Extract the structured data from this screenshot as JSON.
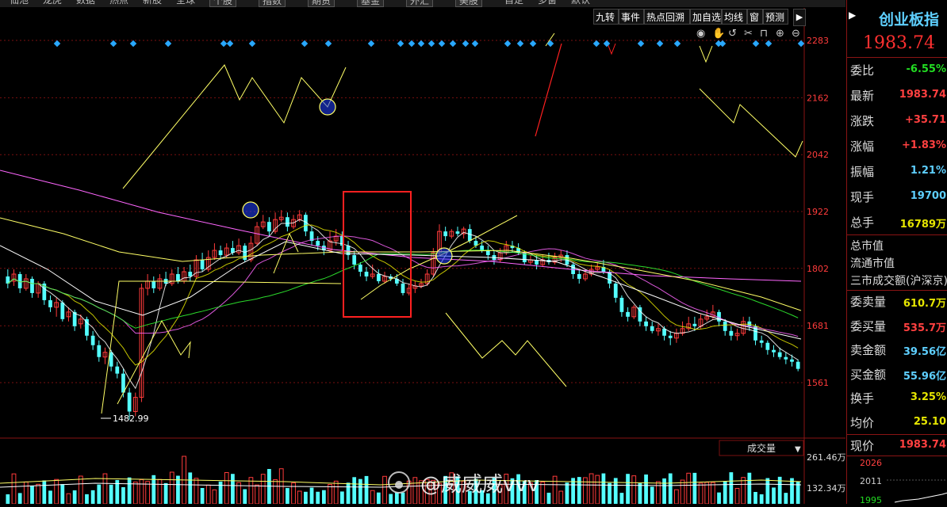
{
  "top_tabs": [
    "仙池",
    "龙虎",
    "数据",
    "热点",
    "新股",
    "全球",
    "个股",
    "指数",
    "期货",
    "基金",
    "外汇",
    "美股",
    "自定",
    "多窗",
    "默认"
  ],
  "toolbar": {
    "buttons": [
      "九转",
      "事件",
      "热点回溯",
      "加自选",
      "均线",
      "窗",
      "预测"
    ],
    "chart_icons": [
      "eye-icon",
      "hand-icon",
      "undo-icon",
      "cut-icon",
      "lock-icon",
      "zoom-in-icon",
      "zoom-out-icon"
    ]
  },
  "y_axis_labels": [
    "2283",
    "2162",
    "2042",
    "1922",
    "1802",
    "1681",
    "1561"
  ],
  "volume": {
    "indicator_label": "成交量",
    "axis_labels": [
      "261.46万",
      "132.34万"
    ]
  },
  "low_marker_label": "1482.99",
  "watermark": "@威威威vvv",
  "right_panel": {
    "title": "创业板指",
    "price": "1983.74",
    "rows": [
      {
        "label": "委比",
        "value": "-6.55%",
        "color": "#22dd22"
      },
      {
        "label": "最新",
        "value": "1983.74",
        "color": "#ff4040"
      },
      {
        "label": "涨跌",
        "value": "+35.71",
        "color": "#ff4040"
      },
      {
        "label": "涨幅",
        "value": "+1.83%",
        "color": "#ff4040"
      },
      {
        "label": "振幅",
        "value": "1.21%",
        "color": "#5ecfff"
      },
      {
        "label": "现手",
        "value": "19700",
        "color": "#5ecfff"
      },
      {
        "label": "总手",
        "value": "16789万",
        "color": "#e6e600"
      }
    ],
    "rows2": [
      {
        "label": "总市值",
        "value": ""
      },
      {
        "label": "流通市值",
        "value": ""
      },
      {
        "label": "三市成交额(沪深京)",
        "value": ""
      }
    ],
    "rows3": [
      {
        "label": "委卖量",
        "value": "610.7万",
        "color": "#e6e600"
      },
      {
        "label": "委买量",
        "value": "535.7万",
        "color": "#ff4040"
      },
      {
        "label": "卖金额",
        "value": "39.56亿",
        "color": "#5ecfff"
      },
      {
        "label": "买金额",
        "value": "55.96亿",
        "color": "#5ecfff"
      },
      {
        "label": "换手",
        "value": "3.25%",
        "color": "#e6e600"
      },
      {
        "label": "均价",
        "value": "25.10",
        "color": "#e6e600"
      }
    ],
    "last_row": {
      "label": "现价",
      "value": "1983.74",
      "color": "#ff4040"
    },
    "mini_axis": [
      "2026",
      "2011",
      "1995"
    ]
  },
  "chart_data": {
    "type": "candlestick",
    "ylim": [
      1440,
      2340
    ],
    "y_ticks": [
      2283,
      2162,
      2042,
      1922,
      1802,
      1681,
      1561
    ],
    "low_point": 1482.99,
    "candles": [
      [
        1785,
        1770,
        1800,
        1760
      ],
      [
        1775,
        1790,
        1800,
        1765
      ],
      [
        1790,
        1760,
        1795,
        1750
      ],
      [
        1760,
        1780,
        1790,
        1755
      ],
      [
        1780,
        1750,
        1785,
        1740
      ],
      [
        1750,
        1770,
        1775,
        1740
      ],
      [
        1770,
        1735,
        1775,
        1725
      ],
      [
        1735,
        1720,
        1745,
        1710
      ],
      [
        1720,
        1730,
        1740,
        1700
      ],
      [
        1730,
        1695,
        1735,
        1690
      ],
      [
        1700,
        1710,
        1720,
        1690
      ],
      [
        1710,
        1680,
        1715,
        1670
      ],
      [
        1685,
        1695,
        1705,
        1675
      ],
      [
        1695,
        1660,
        1700,
        1650
      ],
      [
        1660,
        1640,
        1670,
        1630
      ],
      [
        1640,
        1615,
        1650,
        1605
      ],
      [
        1615,
        1625,
        1635,
        1600
      ],
      [
        1625,
        1595,
        1630,
        1585
      ],
      [
        1595,
        1580,
        1605,
        1570
      ],
      [
        1580,
        1540,
        1590,
        1530
      ],
      [
        1540,
        1500,
        1550,
        1483
      ],
      [
        1500,
        1530,
        1540,
        1490
      ],
      [
        1530,
        1760,
        1770,
        1520
      ],
      [
        1760,
        1775,
        1790,
        1745
      ],
      [
        1775,
        1760,
        1785,
        1750
      ],
      [
        1760,
        1780,
        1790,
        1755
      ],
      [
        1780,
        1770,
        1795,
        1765
      ],
      [
        1770,
        1790,
        1800,
        1765
      ],
      [
        1790,
        1775,
        1805,
        1770
      ],
      [
        1775,
        1795,
        1805,
        1770
      ],
      [
        1795,
        1785,
        1810,
        1775
      ],
      [
        1785,
        1820,
        1830,
        1780
      ],
      [
        1820,
        1800,
        1835,
        1795
      ],
      [
        1800,
        1825,
        1840,
        1795
      ],
      [
        1825,
        1840,
        1855,
        1820
      ],
      [
        1840,
        1830,
        1850,
        1820
      ],
      [
        1830,
        1845,
        1855,
        1825
      ],
      [
        1845,
        1835,
        1860,
        1830
      ],
      [
        1835,
        1850,
        1865,
        1830
      ],
      [
        1850,
        1820,
        1855,
        1815
      ],
      [
        1820,
        1855,
        1870,
        1815
      ],
      [
        1855,
        1890,
        1900,
        1850
      ],
      [
        1890,
        1900,
        1915,
        1885
      ],
      [
        1900,
        1880,
        1910,
        1870
      ],
      [
        1880,
        1905,
        1920,
        1875
      ],
      [
        1905,
        1910,
        1925,
        1900
      ],
      [
        1910,
        1890,
        1920,
        1880
      ],
      [
        1890,
        1905,
        1915,
        1885
      ],
      [
        1905,
        1915,
        1925,
        1900
      ],
      [
        1915,
        1880,
        1920,
        1870
      ],
      [
        1880,
        1860,
        1890,
        1850
      ],
      [
        1860,
        1850,
        1870,
        1840
      ],
      [
        1850,
        1840,
        1860,
        1830
      ],
      [
        1840,
        1860,
        1880,
        1835
      ],
      [
        1860,
        1870,
        1885,
        1850
      ],
      [
        1870,
        1850,
        1880,
        1840
      ],
      [
        1850,
        1830,
        1860,
        1820
      ],
      [
        1830,
        1810,
        1840,
        1800
      ],
      [
        1810,
        1795,
        1815,
        1785
      ],
      [
        1795,
        1785,
        1805,
        1775
      ],
      [
        1785,
        1790,
        1810,
        1780
      ],
      [
        1790,
        1775,
        1800,
        1770
      ],
      [
        1775,
        1785,
        1795,
        1770
      ],
      [
        1785,
        1780,
        1790,
        1775
      ],
      [
        1780,
        1770,
        1790,
        1765
      ],
      [
        1770,
        1750,
        1780,
        1745
      ],
      [
        1750,
        1760,
        1770,
        1745
      ],
      [
        1760,
        1765,
        1775,
        1750
      ],
      [
        1765,
        1770,
        1780,
        1760
      ],
      [
        1770,
        1790,
        1800,
        1765
      ],
      [
        1790,
        1835,
        1845,
        1785
      ],
      [
        1835,
        1880,
        1895,
        1830
      ],
      [
        1880,
        1870,
        1890,
        1860
      ],
      [
        1870,
        1880,
        1885,
        1865
      ],
      [
        1880,
        1875,
        1890,
        1870
      ],
      [
        1875,
        1885,
        1890,
        1865
      ],
      [
        1885,
        1860,
        1895,
        1855
      ],
      [
        1860,
        1850,
        1870,
        1845
      ],
      [
        1850,
        1840,
        1860,
        1835
      ],
      [
        1840,
        1830,
        1850,
        1820
      ],
      [
        1830,
        1820,
        1840,
        1810
      ],
      [
        1820,
        1835,
        1845,
        1815
      ],
      [
        1835,
        1850,
        1860,
        1830
      ],
      [
        1850,
        1845,
        1860,
        1835
      ],
      [
        1845,
        1835,
        1855,
        1830
      ],
      [
        1835,
        1815,
        1840,
        1810
      ],
      [
        1815,
        1820,
        1830,
        1810
      ],
      [
        1820,
        1810,
        1830,
        1800
      ],
      [
        1810,
        1820,
        1830,
        1805
      ],
      [
        1820,
        1815,
        1835,
        1810
      ],
      [
        1815,
        1825,
        1835,
        1810
      ],
      [
        1825,
        1830,
        1840,
        1815
      ],
      [
        1830,
        1810,
        1840,
        1805
      ],
      [
        1810,
        1790,
        1815,
        1780
      ],
      [
        1790,
        1780,
        1800,
        1770
      ],
      [
        1780,
        1790,
        1800,
        1775
      ],
      [
        1790,
        1800,
        1810,
        1785
      ],
      [
        1800,
        1805,
        1815,
        1795
      ],
      [
        1805,
        1795,
        1820,
        1790
      ],
      [
        1795,
        1770,
        1800,
        1760
      ],
      [
        1770,
        1740,
        1775,
        1730
      ],
      [
        1740,
        1710,
        1745,
        1700
      ],
      [
        1710,
        1700,
        1720,
        1690
      ],
      [
        1700,
        1720,
        1725,
        1695
      ],
      [
        1720,
        1690,
        1725,
        1680
      ],
      [
        1690,
        1680,
        1700,
        1670
      ],
      [
        1680,
        1670,
        1690,
        1665
      ],
      [
        1670,
        1675,
        1685,
        1660
      ],
      [
        1675,
        1660,
        1680,
        1650
      ],
      [
        1660,
        1655,
        1670,
        1640
      ],
      [
        1655,
        1665,
        1675,
        1645
      ],
      [
        1665,
        1675,
        1690,
        1660
      ],
      [
        1675,
        1685,
        1700,
        1670
      ],
      [
        1685,
        1680,
        1700,
        1670
      ],
      [
        1680,
        1695,
        1705,
        1675
      ],
      [
        1695,
        1700,
        1715,
        1690
      ],
      [
        1700,
        1710,
        1725,
        1695
      ],
      [
        1710,
        1690,
        1715,
        1680
      ],
      [
        1690,
        1670,
        1695,
        1660
      ],
      [
        1670,
        1660,
        1680,
        1650
      ],
      [
        1660,
        1665,
        1675,
        1650
      ],
      [
        1665,
        1690,
        1700,
        1660
      ],
      [
        1690,
        1680,
        1700,
        1670
      ],
      [
        1680,
        1650,
        1685,
        1640
      ],
      [
        1650,
        1645,
        1660,
        1635
      ],
      [
        1645,
        1630,
        1650,
        1620
      ],
      [
        1630,
        1625,
        1640,
        1615
      ],
      [
        1625,
        1615,
        1635,
        1610
      ],
      [
        1615,
        1610,
        1625,
        1600
      ],
      [
        1610,
        1605,
        1620,
        1595
      ],
      [
        1605,
        1590,
        1610,
        1585
      ]
    ]
  }
}
